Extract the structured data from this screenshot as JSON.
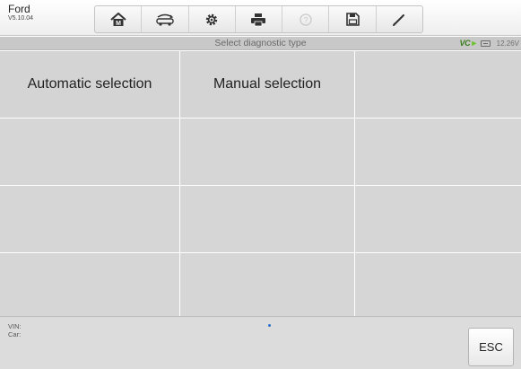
{
  "app": {
    "make": "Ford",
    "version": "V5.10.04"
  },
  "toolbar": {
    "buttons": [
      {
        "icon": "home-icon"
      },
      {
        "icon": "vehicle-swap-icon"
      },
      {
        "icon": "settings-gear-icon"
      },
      {
        "icon": "printer-icon"
      },
      {
        "icon": "help-icon"
      },
      {
        "icon": "save-icon"
      },
      {
        "icon": "edit-pen-icon"
      }
    ]
  },
  "header": {
    "title": "Select diagnostic type",
    "vci_label": "VC",
    "voltage": "12.26V"
  },
  "options": {
    "automatic": "Automatic selection",
    "manual": "Manual selection"
  },
  "footer": {
    "vin_label": "VIN:",
    "car_label": "Car:",
    "esc_label": "ESC"
  },
  "colors": {
    "cell_background": "#d4d4d4",
    "title_strip": "#c8c8c8",
    "vci_green": "#3a7d1e"
  }
}
